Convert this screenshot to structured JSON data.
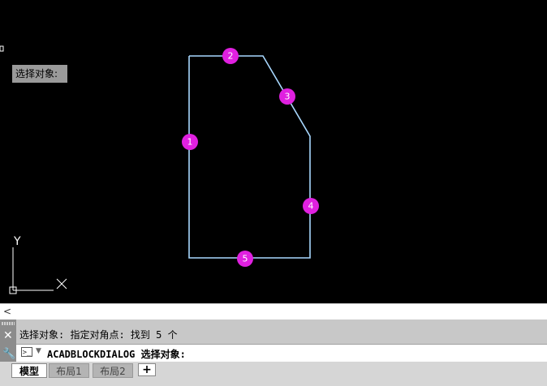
{
  "viewport": {
    "background": "#000000",
    "cursor_tooltip": "选择对象:",
    "polyline_color": "#a8d8ff",
    "marker_color": "#e020e0",
    "markers": [
      "1",
      "2",
      "3",
      "4",
      "5"
    ],
    "ucs": {
      "x_label": "X",
      "y_label": "Y"
    }
  },
  "command_panel": {
    "history": "选择对象: 指定对角点: 找到 5 个",
    "prompt_icon": ">_",
    "command_text": "ACADBLOCKDIALOG 选择对象:"
  },
  "layout_tabs": {
    "tabs": [
      "模型",
      "布局1",
      "布局2"
    ],
    "active": "模型",
    "add_label": "+"
  }
}
